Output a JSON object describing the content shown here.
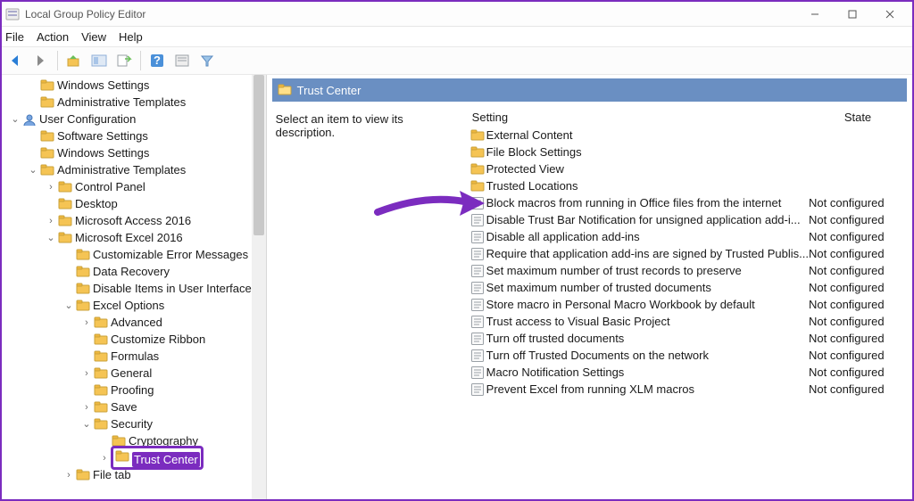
{
  "window": {
    "title": "Local Group Policy Editor"
  },
  "menubar": [
    "File",
    "Action",
    "View",
    "Help"
  ],
  "tree": [
    {
      "depth": 1,
      "twist": "",
      "icon": "folder",
      "label": "Windows Settings"
    },
    {
      "depth": 1,
      "twist": "",
      "icon": "folder",
      "label": "Administrative Templates"
    },
    {
      "depth": 0,
      "twist": "v",
      "icon": "user",
      "label": "User Configuration"
    },
    {
      "depth": 1,
      "twist": "",
      "icon": "folder",
      "label": "Software Settings"
    },
    {
      "depth": 1,
      "twist": "",
      "icon": "folder",
      "label": "Windows Settings"
    },
    {
      "depth": 1,
      "twist": "v",
      "icon": "folder",
      "label": "Administrative Templates"
    },
    {
      "depth": 2,
      "twist": ">",
      "icon": "folder",
      "label": "Control Panel"
    },
    {
      "depth": 2,
      "twist": "",
      "icon": "folder",
      "label": "Desktop"
    },
    {
      "depth": 2,
      "twist": ">",
      "icon": "folder",
      "label": "Microsoft Access 2016"
    },
    {
      "depth": 2,
      "twist": "v",
      "icon": "folder",
      "label": "Microsoft Excel 2016"
    },
    {
      "depth": 3,
      "twist": "",
      "icon": "folder",
      "label": "Customizable Error Messages"
    },
    {
      "depth": 3,
      "twist": "",
      "icon": "folder",
      "label": "Data Recovery"
    },
    {
      "depth": 3,
      "twist": "",
      "icon": "folder",
      "label": "Disable Items in User Interface"
    },
    {
      "depth": 3,
      "twist": "v",
      "icon": "folder",
      "label": "Excel Options"
    },
    {
      "depth": 4,
      "twist": ">",
      "icon": "folder",
      "label": "Advanced"
    },
    {
      "depth": 4,
      "twist": "",
      "icon": "folder",
      "label": "Customize Ribbon"
    },
    {
      "depth": 4,
      "twist": "",
      "icon": "folder",
      "label": "Formulas"
    },
    {
      "depth": 4,
      "twist": ">",
      "icon": "folder",
      "label": "General"
    },
    {
      "depth": 4,
      "twist": "",
      "icon": "folder",
      "label": "Proofing"
    },
    {
      "depth": 4,
      "twist": ">",
      "icon": "folder",
      "label": "Save"
    },
    {
      "depth": 4,
      "twist": "v",
      "icon": "folder",
      "label": "Security"
    },
    {
      "depth": 5,
      "twist": "",
      "icon": "folder",
      "label": "Cryptography"
    },
    {
      "depth": 5,
      "twist": ">",
      "icon": "folder",
      "label": "Trust Center",
      "selected": true
    },
    {
      "depth": 3,
      "twist": ">",
      "icon": "folder",
      "label": "File tab"
    }
  ],
  "details": {
    "header": "Trust Center",
    "desc": "Select an item to view its description.",
    "col_setting": "Setting",
    "col_state": "State",
    "rows": [
      {
        "icon": "folder",
        "name": "External Content",
        "state": ""
      },
      {
        "icon": "folder",
        "name": "File Block Settings",
        "state": ""
      },
      {
        "icon": "folder",
        "name": "Protected View",
        "state": ""
      },
      {
        "icon": "folder",
        "name": "Trusted Locations",
        "state": ""
      },
      {
        "icon": "setting",
        "name": "Block macros from running in Office files from the internet",
        "state": "Not configured"
      },
      {
        "icon": "setting",
        "name": "Disable Trust Bar Notification for unsigned application add-i...",
        "state": "Not configured"
      },
      {
        "icon": "setting",
        "name": "Disable all application add-ins",
        "state": "Not configured"
      },
      {
        "icon": "setting",
        "name": "Require that application add-ins are signed by Trusted Publis...",
        "state": "Not configured"
      },
      {
        "icon": "setting",
        "name": "Set maximum number of trust records to preserve",
        "state": "Not configured"
      },
      {
        "icon": "setting",
        "name": "Set maximum number of trusted documents",
        "state": "Not configured"
      },
      {
        "icon": "setting",
        "name": "Store macro in Personal Macro Workbook by default",
        "state": "Not configured"
      },
      {
        "icon": "setting",
        "name": "Trust access to Visual Basic Project",
        "state": "Not configured"
      },
      {
        "icon": "setting",
        "name": "Turn off trusted documents",
        "state": "Not configured"
      },
      {
        "icon": "setting",
        "name": "Turn off Trusted Documents on the network",
        "state": "Not configured"
      },
      {
        "icon": "setting",
        "name": "Macro Notification Settings",
        "state": "Not configured"
      },
      {
        "icon": "setting",
        "name": "Prevent Excel from running XLM macros",
        "state": "Not configured"
      }
    ]
  }
}
